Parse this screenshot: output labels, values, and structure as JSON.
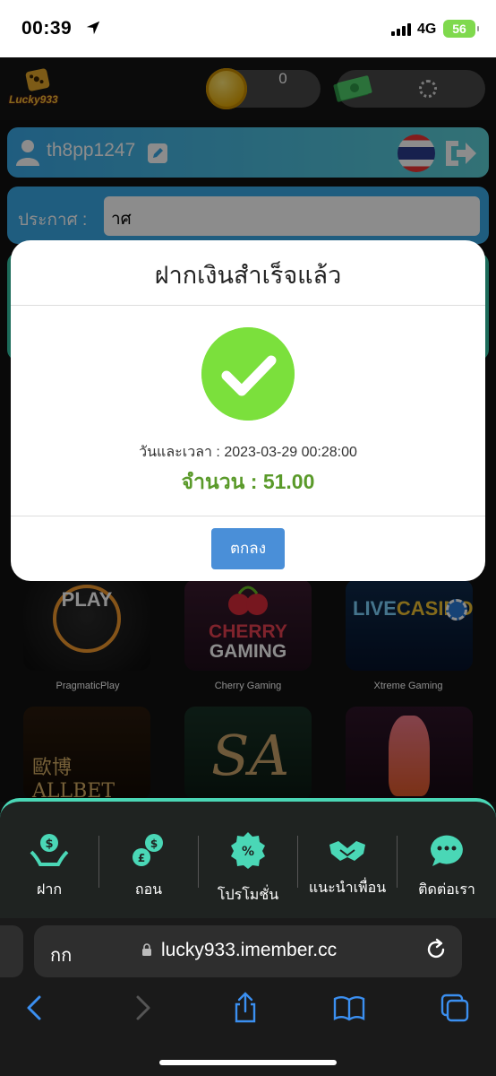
{
  "status_bar": {
    "time": "00:39",
    "network": "4G",
    "battery": "56"
  },
  "header": {
    "logo_text": "Lucky933",
    "coin_balance": "0"
  },
  "user": {
    "username": "th8pp1247"
  },
  "announcement": {
    "label": "ประกาศ :",
    "text": "าศ"
  },
  "modal": {
    "title": "ฝากเงินสำเร็จแล้ว",
    "datetime": "วันและเวลา : 2023-03-29 00:28:00",
    "amount": "จำนวน : 51.00",
    "ok_label": "ตกลง"
  },
  "games": [
    {
      "name": "PragmaticPlay",
      "logo": "PLAY"
    },
    {
      "name": "Cherry Gaming",
      "logo_line1": "CHERRY",
      "logo_line2": "GAMING"
    },
    {
      "name": "Xtreme Gaming",
      "logo_part1": "LIVE",
      "logo_part2": "CASINOS"
    },
    {
      "logo": "歐博ALLBET"
    },
    {
      "logo": "SA"
    },
    {
      "logo": ""
    }
  ],
  "bottom_nav": [
    {
      "label": "ฝาก",
      "icon": "deposit-icon"
    },
    {
      "label": "ถอน",
      "icon": "withdraw-icon"
    },
    {
      "label": "โปรโมชั่น",
      "icon": "promotion-icon"
    },
    {
      "label": "แนะนำเพื่อน",
      "icon": "handshake-icon"
    },
    {
      "label": "ติดต่อเรา",
      "icon": "chat-support-icon"
    }
  ],
  "browser": {
    "aa_label": "กก",
    "url": "lucky933.imember.cc"
  },
  "colors": {
    "accent_teal": "#4ad7b6",
    "user_bar_blue": "#3aa9e8",
    "success_green": "#7be03c",
    "amount_green": "#5a9a2a",
    "ok_button": "#4a8fd8"
  }
}
